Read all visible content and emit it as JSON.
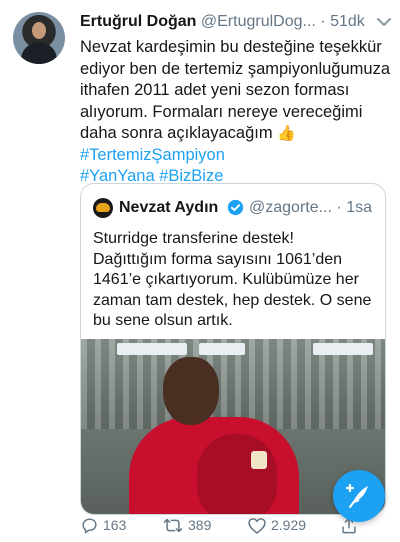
{
  "tweet": {
    "author_name": "Ertuğrul Doğan",
    "author_handle": "@ErtugrulDog...",
    "separator": "·",
    "time": "51dk",
    "text": "Nevzat kardeşimin bu desteğine teşekkür ediyor ben de tertemiz şampiyonluğumuza ithafen 2011 adet yeni sezon forması alıyorum. Formaları nereye vereceğimi daha sonra açıklayacağım",
    "emoji": "👍",
    "hashtag_inline": "#TertemizŞampiyon",
    "hashtags_line": "#YanYana #BizBize"
  },
  "quote": {
    "author_name": "Nevzat Aydın",
    "author_handle": "@zagorte...",
    "separator": "·",
    "time": "1sa",
    "text": "Sturridge transferine destek!\nDağıttığım forma sayısını 1061’den 1461’e çıkartıyorum. Kulübümüze her zaman tam destek, hep destek. O sene bu sene olsun artık."
  },
  "actions": {
    "reply_count": "163",
    "retweet_count": "389",
    "like_count": "2.929"
  },
  "icons": {
    "more": "chevron-down-icon",
    "verified": "verified-badge-icon",
    "reply": "reply-icon",
    "retweet": "retweet-icon",
    "like": "heart-icon",
    "share": "share-icon",
    "compose": "compose-tweet-icon"
  },
  "colors": {
    "accent": "#1da1f2",
    "secondary_text": "#657786",
    "kit_red": "#c8102e"
  }
}
